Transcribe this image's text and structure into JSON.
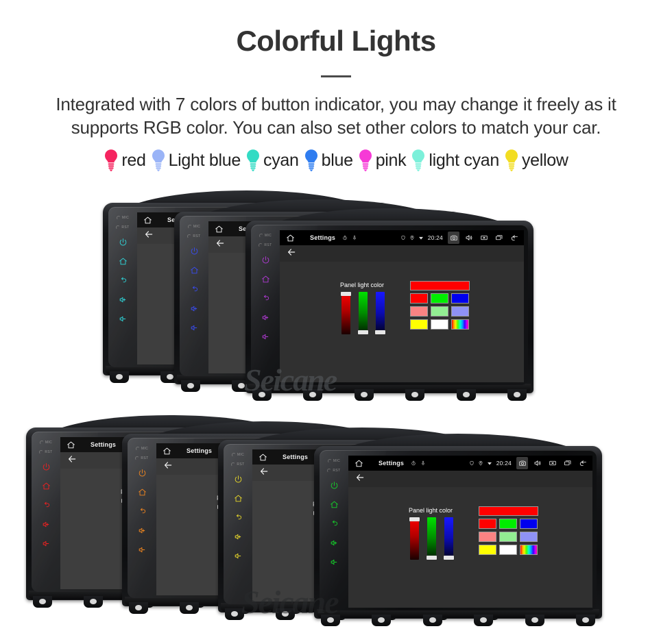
{
  "header": {
    "title": "Colorful Lights",
    "subtitle": "Integrated with 7 colors of button indicator, you may change it freely as it supports RGB color. You can also set other colors to match your car."
  },
  "legend": {
    "items": [
      {
        "label": "red",
        "color": "#f5245f",
        "icon": "bulb-icon"
      },
      {
        "label": "Light blue",
        "color": "#9ab4f7",
        "icon": "bulb-icon"
      },
      {
        "label": "cyan",
        "color": "#33dbc4",
        "icon": "bulb-icon"
      },
      {
        "label": "blue",
        "color": "#2f7df0",
        "icon": "bulb-icon"
      },
      {
        "label": "pink",
        "color": "#f63ad6",
        "icon": "bulb-icon"
      },
      {
        "label": "light cyan",
        "color": "#7cf0da",
        "icon": "bulb-icon"
      },
      {
        "label": "yellow",
        "color": "#f2dd22",
        "icon": "bulb-icon"
      }
    ]
  },
  "device": {
    "statusbar": {
      "home_icon": "home-icon",
      "title": "Settings",
      "mini_icons": [
        "timer-icon",
        "mic-icon"
      ],
      "tray_icons": [
        "shield-icon",
        "location-pin-icon",
        "signal-icon"
      ],
      "clock": "20:24",
      "buttons": [
        {
          "icon": "camera-icon",
          "highlighted": true
        },
        {
          "icon": "volume-icon",
          "highlighted": false
        },
        {
          "icon": "close-box-icon",
          "highlighted": false
        },
        {
          "icon": "recents-icon",
          "highlighted": false
        },
        {
          "icon": "back-arrow-icon",
          "highlighted": false
        }
      ]
    },
    "actionbar": {
      "back_icon": "back-arrow-icon"
    },
    "bezel": {
      "labels": [
        "MIC",
        "RST"
      ],
      "icons": [
        "power-icon",
        "home-icon",
        "back-icon",
        "volume-up-icon",
        "volume-down-icon"
      ]
    },
    "settings": {
      "panel_light_label": "Panel light color",
      "sliders": [
        {
          "channel": "R",
          "value": 255,
          "thumb": "top"
        },
        {
          "channel": "G",
          "value": 0,
          "thumb": "bottom"
        },
        {
          "channel": "B",
          "value": 0,
          "thumb": "bottom"
        }
      ],
      "preview_color": "#ff0000",
      "swatch_rows": [
        [
          "#ff0000",
          "#00ee00",
          "#0000ee"
        ],
        [
          "#fa8383",
          "#92ee92",
          "#8f92f5"
        ],
        [
          "#ffff00",
          "#ffffff",
          "rainbow"
        ]
      ]
    }
  },
  "groups": {
    "top": {
      "bezel_colors": [
        "#1fd3d8",
        "#2b3ff2",
        "#b23ad6"
      ],
      "front_index": 2
    },
    "bottom": {
      "bezel_colors": [
        "#f01010",
        "#f07d0e",
        "#e8d61a",
        "#14d42a"
      ],
      "front_index": 3
    }
  },
  "watermark": {
    "text": "Seicane"
  }
}
